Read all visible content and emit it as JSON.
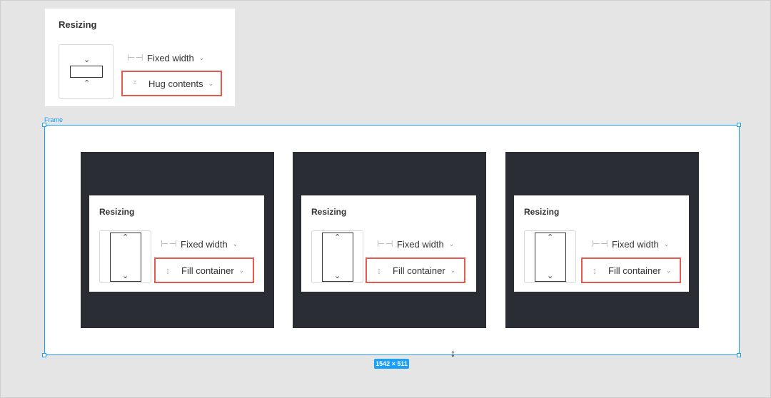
{
  "top_panel": {
    "title": "Resizing",
    "width_row": {
      "icon": "fixed-width-icon",
      "label": "Fixed width"
    },
    "height_row": {
      "icon": "hug-contents-icon",
      "label": "Hug contents"
    }
  },
  "frame": {
    "label": "Frame",
    "size_badge": "1542 × 511"
  },
  "cards": [
    {
      "title": "Resizing",
      "width_label": "Fixed width",
      "height_label": "Fill container"
    },
    {
      "title": "Resizing",
      "width_label": "Fixed width",
      "height_label": "Fill container"
    },
    {
      "title": "Resizing",
      "width_label": "Fixed width",
      "height_label": "Fill container"
    }
  ],
  "colors": {
    "canvas": "#e5e5e5",
    "selection": "#18a0fb",
    "highlight": "#e8584f",
    "dark_card": "#2b2d35"
  }
}
